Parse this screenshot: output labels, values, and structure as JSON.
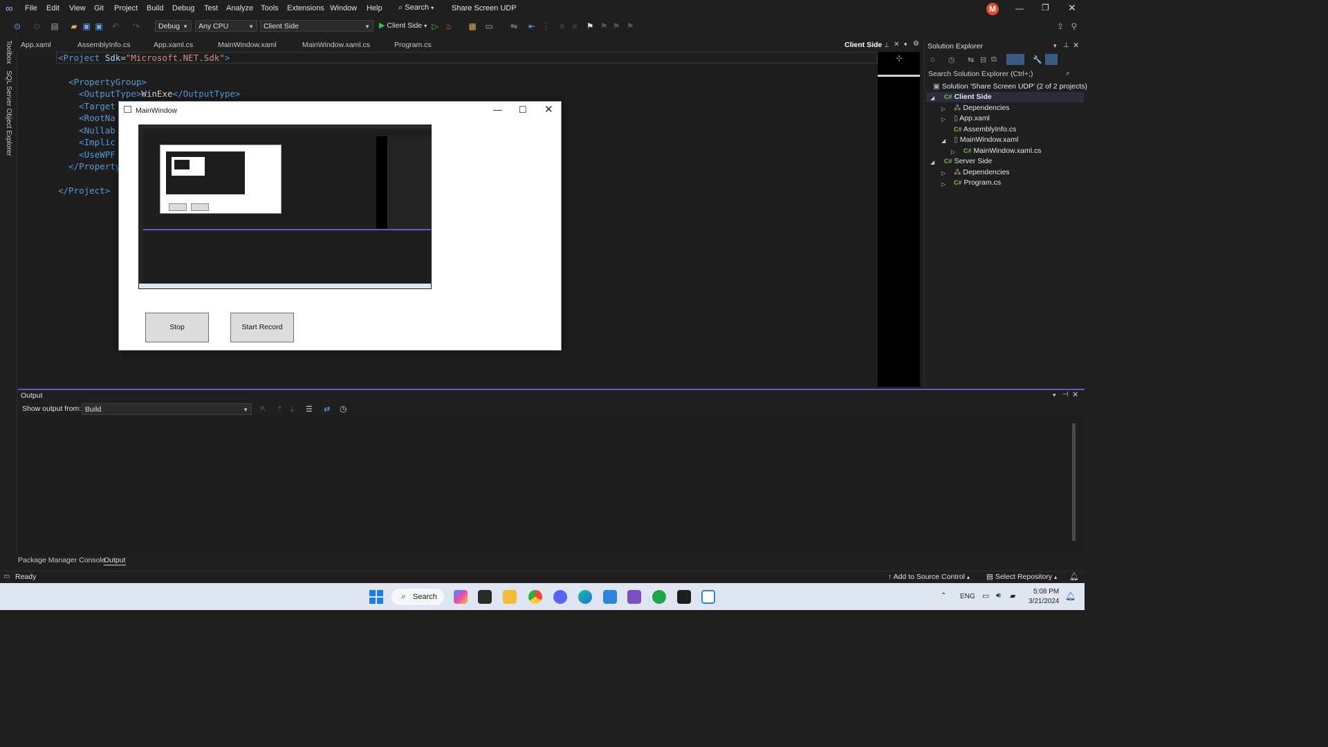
{
  "menubar": {
    "items": [
      "File",
      "Edit",
      "View",
      "Git",
      "Project",
      "Build",
      "Debug",
      "Test",
      "Analyze",
      "Tools",
      "Extensions",
      "Window",
      "Help"
    ],
    "search": "Search",
    "solution_title": "Share Screen UDP",
    "avatar_letter": "M"
  },
  "toolbar": {
    "config": "Debug",
    "platform": "Any CPU",
    "startup_project": "Client Side",
    "run_label": "Client Side"
  },
  "left_strip": {
    "toolbox": "Toolbox",
    "sql": "SQL Server Object Explorer"
  },
  "tabs": [
    "App.xaml",
    "AssemblyInfo.cs",
    "App.xaml.cs",
    "MainWindow.xaml",
    "MainWindow.xaml.cs",
    "Program.cs"
  ],
  "active_tab_label": "Client Side",
  "editor": {
    "lines": [
      {
        "indent": "",
        "tag_open": "<Project",
        "attr": " Sdk",
        "eq": "=",
        "str": "\"Microsoft.NET.Sdk\"",
        "tail": ">"
      },
      {
        "indent": "  ",
        "text": "<PropertyGroup>"
      },
      {
        "indent": "    ",
        "tag": "<OutputType>",
        "value": "WinExe",
        "close": "</OutputType>"
      },
      {
        "indent": "    ",
        "text": "<Target"
      },
      {
        "indent": "    ",
        "text": "<RootNa"
      },
      {
        "indent": "    ",
        "text": "<Nullab"
      },
      {
        "indent": "    ",
        "text": "<Implic"
      },
      {
        "indent": "    ",
        "text": "<UseWPF"
      },
      {
        "indent": "  ",
        "text": "</Property"
      },
      {
        "indent": "",
        "text": "</Project>"
      }
    ]
  },
  "solution_explorer": {
    "title": "Solution Explorer",
    "search_placeholder": "Search Solution Explorer (Ctrl+;)",
    "solution": "Solution 'Share Screen UDP' (2 of 2 projects)",
    "items": [
      {
        "label": "Client Side",
        "bold": true
      },
      {
        "label": "Dependencies"
      },
      {
        "label": "App.xaml"
      },
      {
        "label": "AssemblyInfo.cs"
      },
      {
        "label": "MainWindow.xaml"
      },
      {
        "label": "MainWindow.xaml.cs"
      },
      {
        "label": "Server Side"
      },
      {
        "label": "Dependencies"
      },
      {
        "label": "Program.cs"
      }
    ]
  },
  "output": {
    "title": "Output",
    "show_from_label": "Show output from:",
    "source": "Build"
  },
  "bottom_tabs": [
    "Package Manager Console",
    "Output"
  ],
  "statusbar": {
    "ready": "Ready",
    "source_control": "Add to Source Control",
    "repository": "Select Repository"
  },
  "taskbar": {
    "search": "Search",
    "lang": "ENG",
    "time": "5:08 PM",
    "date": "3/21/2024"
  },
  "dialog": {
    "title": "MainWindow",
    "stop_button": "Stop",
    "record_button": "Start Record"
  }
}
